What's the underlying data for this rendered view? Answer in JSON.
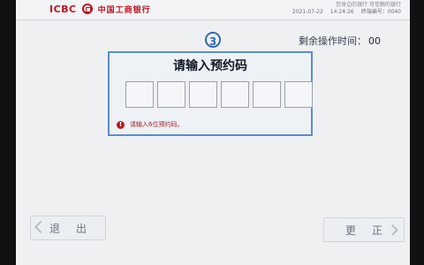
{
  "header": {
    "brand_en": "ICBC",
    "brand_cn": "中国工商银行",
    "meta_line1": "您身边的银行 可信赖的银行",
    "date": "2021-07-22",
    "time": "14:24:26",
    "terminal": "终端编号：0040"
  },
  "step": {
    "number": "3"
  },
  "timer": {
    "label": "剩余操作时间：",
    "value": "00"
  },
  "panel": {
    "title": "请输入预约码",
    "code_boxes": [
      "",
      "",
      "",
      "",
      "",
      ""
    ],
    "hint": "请输入6位预约码。"
  },
  "buttons": {
    "exit": "退出",
    "change": "更正"
  },
  "colors": {
    "brand_red": "#c1121f",
    "panel_border": "#5b8ccc",
    "hint_red": "#9f1d1d"
  },
  "icons": {
    "logo": "icbc-logo-icon",
    "warning": "error-circle-icon",
    "left_arrow": "chevron-left-icon",
    "right_arrow": "chevron-right-icon"
  }
}
